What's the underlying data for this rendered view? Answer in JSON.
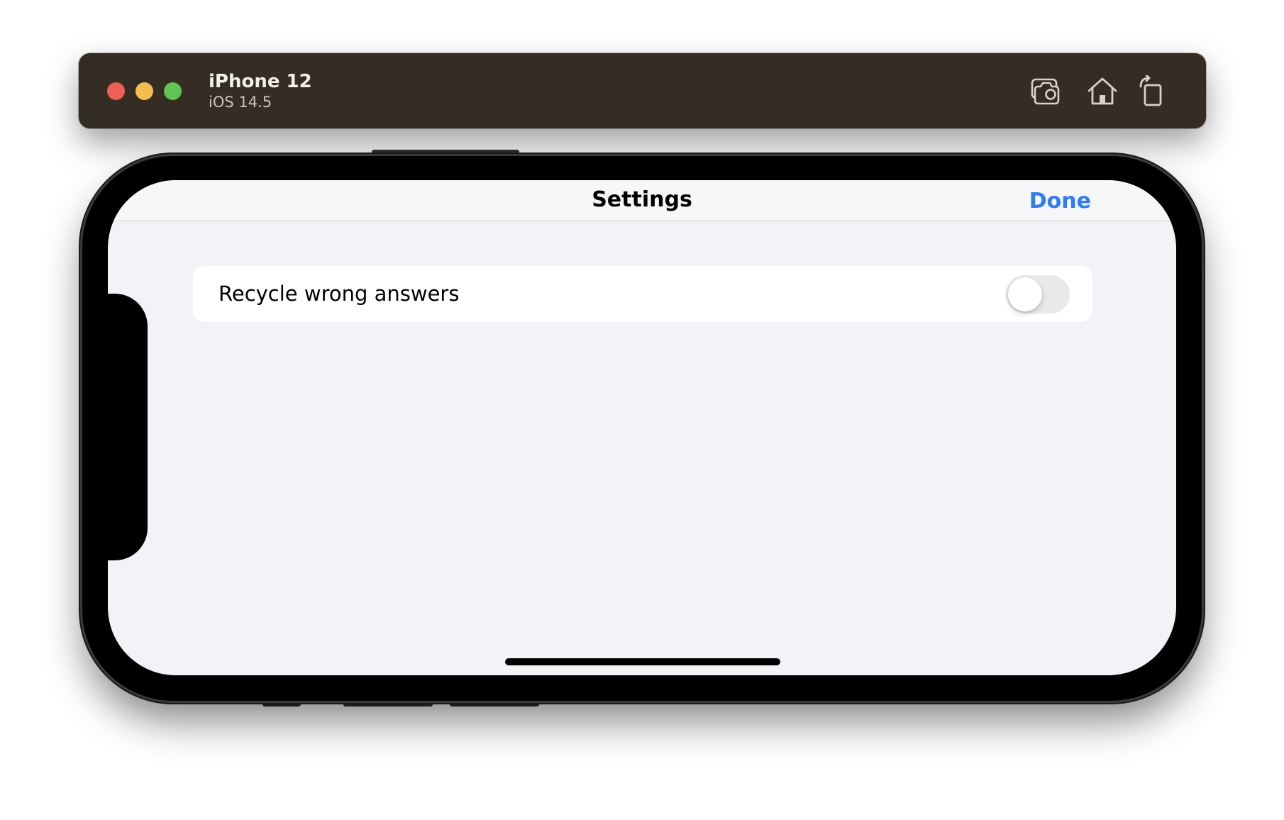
{
  "simulator": {
    "device_name": "iPhone 12",
    "os_version": "iOS 14.5",
    "icons": {
      "screenshot": "camera-icon",
      "home": "home-icon",
      "rotate": "rotate-icon"
    },
    "colors": {
      "titlebar": "#352d23",
      "close": "#ed5f57",
      "minimize": "#f4bd4f",
      "zoom": "#5fc454"
    }
  },
  "app": {
    "nav": {
      "title": "Settings",
      "done_label": "Done"
    },
    "settings": [
      {
        "label": "Recycle wrong answers",
        "enabled": false
      }
    ],
    "colors": {
      "accent": "#2f7cf6",
      "background": "#f2f2f7",
      "toggle_off": "#e9e9eb"
    }
  }
}
